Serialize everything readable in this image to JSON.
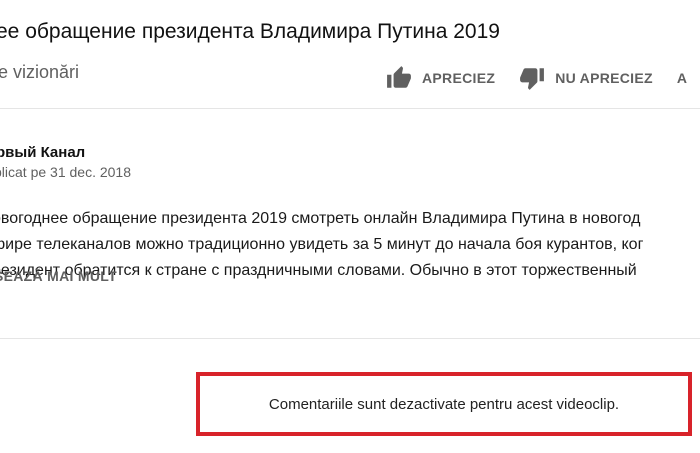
{
  "video": {
    "title": "ee обращение президента Владимира Путина 2019",
    "views": "le vizionări"
  },
  "actions": {
    "like_label": "APRECIEZ",
    "dislike_label": "NU APRECIEZ",
    "more_label": "A"
  },
  "channel": {
    "name": "рвый Канал",
    "published": "blicat pe 31 dec. 2018"
  },
  "description": {
    "lines": [
      "овогоднее обращение президента 2019 смотреть онлайн Владимира Путина в новогод",
      "фире телеканалов можно традиционно увидеть за 5 минут до начала боя курантов, ког",
      "резидент обратится к стране с праздничными словами. Обычно в этот торжественный"
    ],
    "show_more": "ȘEAZĂ MAI MULT"
  },
  "comments": {
    "disabled_message": "Comentariile sunt dezactivate pentru acest videoclip."
  },
  "colors": {
    "highlight_border": "#d8232a",
    "secondary_text": "#606060"
  },
  "icons": [
    "thumbs-up-icon",
    "thumbs-down-icon"
  ]
}
